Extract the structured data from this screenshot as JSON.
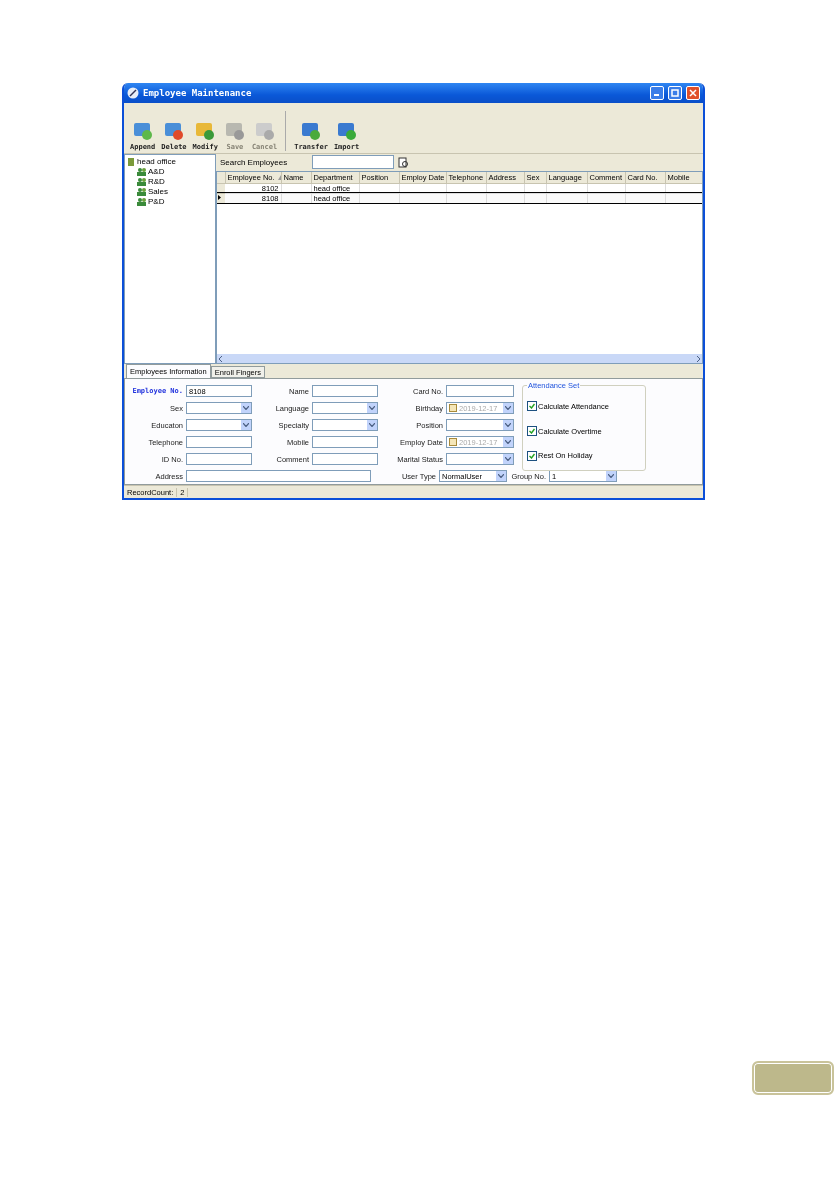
{
  "window": {
    "title": "Employee Maintenance"
  },
  "toolbar": [
    {
      "label": "Append",
      "disabled": false
    },
    {
      "label": "Delete",
      "disabled": false
    },
    {
      "label": "Modify",
      "disabled": false
    },
    {
      "label": "Save",
      "disabled": true
    },
    {
      "label": "Cancel",
      "disabled": true
    },
    {
      "label": "Transfer",
      "disabled": false
    },
    {
      "label": "Import",
      "disabled": false
    }
  ],
  "tree": {
    "label": "head office",
    "children": [
      {
        "label": "A&D"
      },
      {
        "label": "R&D"
      },
      {
        "label": "Sales"
      },
      {
        "label": "P&D"
      }
    ]
  },
  "search": {
    "label": "Search Employees"
  },
  "table": {
    "columns": [
      {
        "label": "Employee No.",
        "sorted": true
      },
      {
        "label": "Name",
        "sorted": false
      },
      {
        "label": "Department",
        "sorted": false
      },
      {
        "label": "Position",
        "sorted": false
      },
      {
        "label": "Employ Date",
        "sorted": false
      },
      {
        "label": "Telephone",
        "sorted": false
      },
      {
        "label": "Address",
        "sorted": false
      },
      {
        "label": "Sex",
        "sorted": false
      },
      {
        "label": "Language",
        "sorted": false
      },
      {
        "label": "Comment",
        "sorted": false
      },
      {
        "label": "Card No.",
        "sorted": false
      },
      {
        "label": "Mobile",
        "sorted": false
      }
    ],
    "rows": [
      {
        "selected": false,
        "cells": [
          "8102",
          "",
          "head office"
        ]
      },
      {
        "selected": true,
        "cells": [
          "8108",
          "",
          "head office"
        ]
      }
    ]
  },
  "tabs": [
    {
      "label": "Employees Information",
      "selected": true
    },
    {
      "label": "Enroll Fingers",
      "selected": false
    }
  ],
  "form": {
    "rows": [
      [
        {
          "label": "Employee No.",
          "kind": "text",
          "value": "8108",
          "required": true
        },
        {
          "label": "Name",
          "kind": "text",
          "required": false
        },
        {
          "label": "Card No.",
          "kind": "text",
          "required": false
        }
      ],
      [
        {
          "label": "Sex",
          "kind": "select",
          "required": false
        },
        {
          "label": "Language",
          "kind": "select",
          "required": false
        },
        {
          "label": "Birthday",
          "kind": "date",
          "value": "2019-12-17",
          "required": false
        }
      ],
      [
        {
          "label": "Educaton",
          "kind": "select",
          "required": false
        },
        {
          "label": "Specialty",
          "kind": "select",
          "required": false
        },
        {
          "label": "Position",
          "kind": "select",
          "required": false
        }
      ],
      [
        {
          "label": "Telephone",
          "kind": "text",
          "required": false
        },
        {
          "label": "Mobile",
          "kind": "text",
          "required": false
        },
        {
          "label": "Employ Date",
          "kind": "date",
          "value": "2019-12-17",
          "required": false
        }
      ],
      [
        {
          "label": "ID No.",
          "kind": "text",
          "required": false
        },
        {
          "label": "Comment",
          "kind": "text",
          "required": false
        },
        {
          "label": "Marital Status",
          "kind": "select",
          "required": false
        }
      ]
    ],
    "last_row": [
      {
        "label": "Address",
        "kind": "text",
        "required": false
      },
      {
        "label": "User Type",
        "kind": "select",
        "value": "NormalUser",
        "required": false
      },
      {
        "label": "Group No.",
        "kind": "select",
        "value": "1",
        "required": false
      }
    ]
  },
  "attendance": {
    "title": "Attendance Set",
    "options": [
      {
        "label": "Calculate Attendance",
        "checked": true
      },
      {
        "label": "Calculate Overtime",
        "checked": true
      },
      {
        "label": "Rest On Holiday",
        "checked": true
      }
    ]
  },
  "status_bar": {
    "label": "RecordCount:",
    "value": "2"
  }
}
